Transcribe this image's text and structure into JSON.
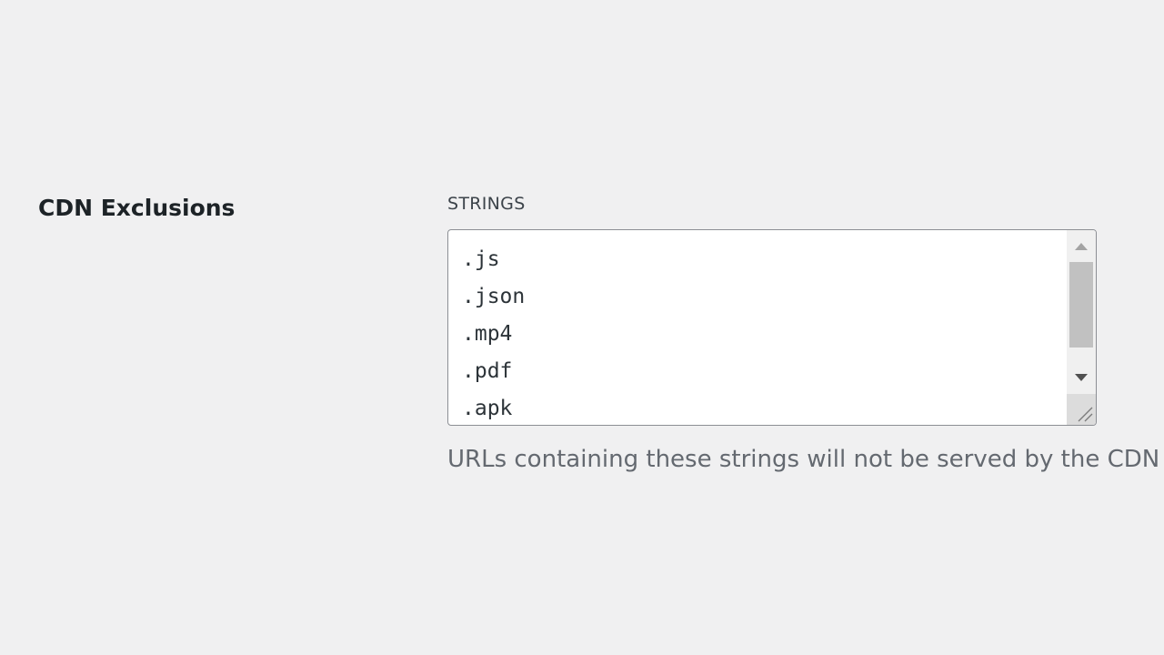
{
  "setting": {
    "label": "CDN Exclusions"
  },
  "strings_field": {
    "label": "STRINGS",
    "lines": [
      ".js",
      ".json",
      ".mp4",
      ".pdf",
      ".apk"
    ],
    "help_text": "URLs containing these strings will not be served by the CDN"
  },
  "icons": {
    "scroll_up": "triangle-up-icon",
    "scroll_down": "triangle-down-icon",
    "resize": "resize-grip-icon"
  }
}
